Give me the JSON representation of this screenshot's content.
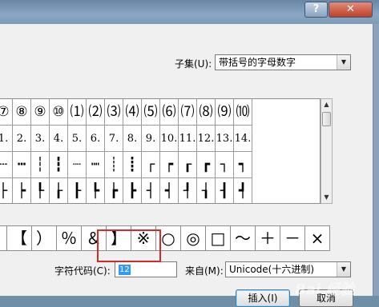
{
  "titlebar": {
    "help_glyph": "?",
    "close_glyph": "✕"
  },
  "subset": {
    "label": "子集(U):",
    "value": "带括号的字母数字"
  },
  "grid": {
    "rows": [
      [
        "⑦",
        "⑧",
        "⑨",
        "⑩",
        "⑴",
        "⑵",
        "⑶",
        "⑷",
        "⑸",
        "⑹",
        "⑺",
        "⑻",
        "⑼",
        "⑽"
      ],
      [
        "1.",
        "2.",
        "3.",
        "4.",
        "5.",
        "6.",
        "7.",
        "8.",
        "9.",
        "10.",
        "11.",
        "12.",
        "13.",
        "14."
      ],
      [
        "┄",
        "┅",
        "┆",
        "┇",
        "┈",
        "┉",
        "┊",
        "┋",
        "┌",
        "┍",
        "┎",
        "┏",
        "┐",
        "┑"
      ],
      [
        "├",
        "┝",
        "┞",
        "┟",
        "┠",
        "┡",
        "┢",
        "┣",
        "┤",
        "┥",
        "┦",
        "┧",
        "┨",
        "┩"
      ]
    ]
  },
  "recent_symbols": [
    "〗",
    "【",
    "）",
    "％",
    "＆",
    "】",
    "※",
    "○",
    "◎",
    "□",
    "～",
    "＋",
    "－",
    "×"
  ],
  "char_code": {
    "label": "字符代码(C):",
    "value": "12"
  },
  "from": {
    "label": "来自(M):",
    "value": "Unicode(十六进制)"
  },
  "buttons": {
    "insert": "插入(I)",
    "cancel": "取消"
  },
  "watermark": "Bai 经验"
}
